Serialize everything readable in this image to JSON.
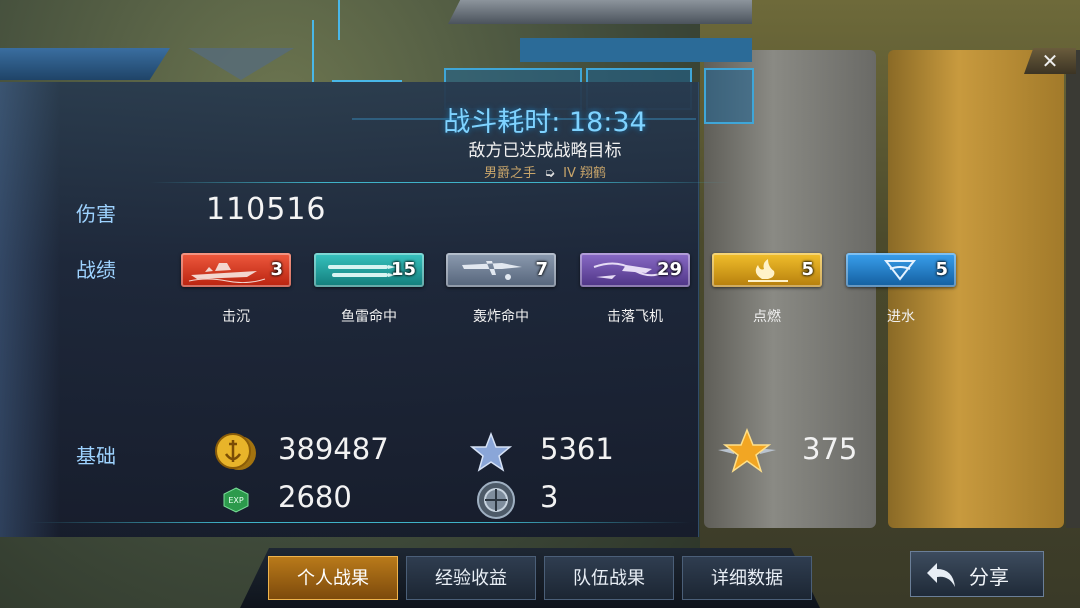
{
  "header": {
    "title": "战斗耗时: 18:34",
    "result": "敌方已达成战略目标",
    "tagline_left": "男爵之手",
    "tagline_arrow": "➭",
    "tagline_right": "IV  翔鹤"
  },
  "damage": {
    "label": "伤害",
    "value": "110516"
  },
  "record": {
    "label": "战绩",
    "badges": [
      {
        "name": "击沉",
        "count": "3",
        "color": "#d9341f",
        "icon": "ship-icon"
      },
      {
        "name": "鱼雷命中",
        "count": "15",
        "color": "#1fa5a2",
        "icon": "torpedo-icon"
      },
      {
        "name": "轰炸命中",
        "count": "7",
        "color": "#6f7f96",
        "icon": "bomber-icon"
      },
      {
        "name": "击落飞机",
        "count": "29",
        "color": "#6c4fa8",
        "icon": "plane-down-icon"
      },
      {
        "name": "点燃",
        "count": "5",
        "color": "#d6a11a",
        "icon": "fire-icon"
      },
      {
        "name": "进水",
        "count": "5",
        "color": "#1f7ec9",
        "icon": "flood-icon"
      }
    ]
  },
  "base": {
    "label": "基础",
    "credits": "389487",
    "exp": "2680",
    "exp_icon_text": "EXP",
    "star_points": "5361",
    "commander_exp": "375",
    "gear_count": "3"
  },
  "tabs": [
    {
      "label": "个人战果",
      "active": true
    },
    {
      "label": "经验收益",
      "active": false
    },
    {
      "label": "队伍战果",
      "active": false
    },
    {
      "label": "详细数据",
      "active": false
    }
  ],
  "share_label": "分享",
  "close_label": "✕",
  "colors": {
    "accent": "#7fd3ff",
    "label": "#9ed3ff",
    "gold": "#c9a56a"
  }
}
